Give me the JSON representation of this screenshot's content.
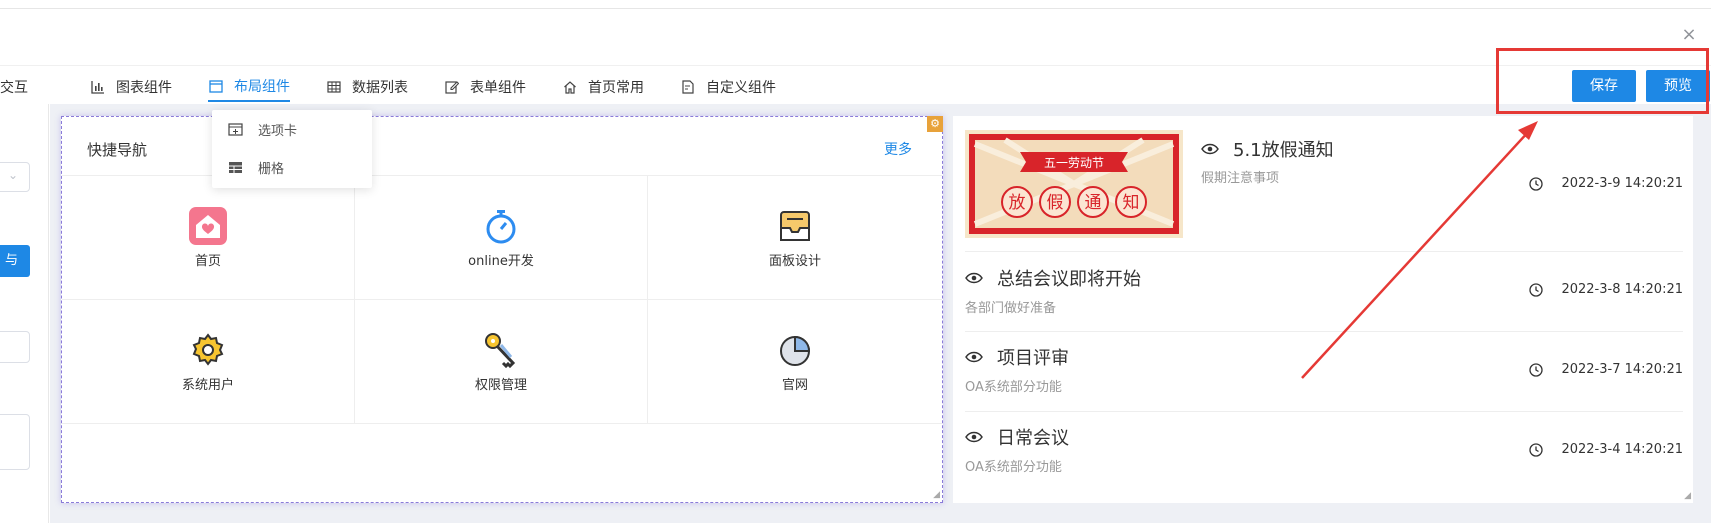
{
  "dialog": {
    "close_label": "×"
  },
  "left_panel": {
    "tab_label": "交互",
    "button_label": "与"
  },
  "tabs": [
    {
      "label": "图表组件",
      "icon": "bar-chart-icon"
    },
    {
      "label": "布局组件",
      "icon": "window-icon"
    },
    {
      "label": "数据列表",
      "icon": "table-icon"
    },
    {
      "label": "表单组件",
      "icon": "edit-icon"
    },
    {
      "label": "首页常用",
      "icon": "home-icon"
    },
    {
      "label": "自定义组件",
      "icon": "file-edit-icon"
    }
  ],
  "active_tab": "布局组件",
  "dropdown": [
    {
      "label": "选项卡",
      "icon": "tab-add-icon"
    },
    {
      "label": "栅格",
      "icon": "grid-icon"
    }
  ],
  "toolbar": {
    "save_label": "保存",
    "preview_label": "预览"
  },
  "nav_card": {
    "title": "快捷导航",
    "more": "更多",
    "items": [
      {
        "label": "首页",
        "icon": "home-heart-icon"
      },
      {
        "label": "online开发",
        "icon": "stopwatch-icon"
      },
      {
        "label": "面板设计",
        "icon": "inbox-icon"
      },
      {
        "label": "系统用户",
        "icon": "gear-icon"
      },
      {
        "label": "权限管理",
        "icon": "keys-icon"
      },
      {
        "label": "官网",
        "icon": "pie-icon"
      }
    ]
  },
  "news": [
    {
      "title": "5.1放假通知",
      "sub": "假期注意事项",
      "time": "2022-3-9 14:20:21",
      "banner": {
        "ribbon": "五一劳动节",
        "chars": [
          "放",
          "假",
          "通",
          "知"
        ]
      }
    },
    {
      "title": "总结会议即将开始",
      "sub": "各部门做好准备",
      "time": "2022-3-8 14:20:21"
    },
    {
      "title": "项目评审",
      "sub": "OA系统部分功能",
      "time": "2022-3-7 14:20:21"
    },
    {
      "title": "日常会议",
      "sub": "OA系统部分功能",
      "time": "2022-3-4 14:20:21"
    }
  ],
  "colors": {
    "primary": "#1e88e5",
    "annotation_red": "#e53935",
    "selection": "#8a7bd9"
  }
}
